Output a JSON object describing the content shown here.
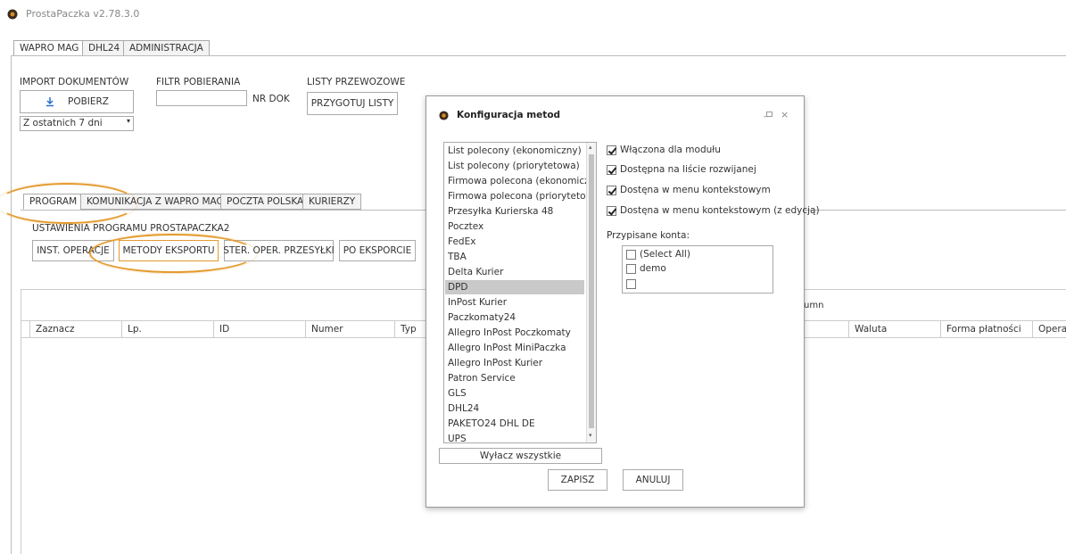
{
  "app": {
    "title": "ProstaPaczka v2.78.3.0",
    "logo_icon": "app-logo-icon"
  },
  "top_tabs": [
    {
      "label": "WAPRO MAG",
      "active": true
    },
    {
      "label": "DHL24",
      "active": false
    },
    {
      "label": "ADMINISTRACJA",
      "active": false
    }
  ],
  "import": {
    "label": "IMPORT DOKUMENTÓW",
    "button": "POBIERZ",
    "button_icon": "download-icon",
    "range_value": "Z ostatnich 7 dni"
  },
  "filter": {
    "label": "FILTR POBIERANIA",
    "value": "",
    "suffix": "NR DOK"
  },
  "waybills": {
    "label": "LISTY PRZEWOZOWE",
    "button": "PRZYGOTUJ LISTY"
  },
  "sub_tabs": [
    {
      "label": "PROGRAM",
      "active": true
    },
    {
      "label": "KOMUNIKACJA Z WAPRO MAG",
      "active": false
    },
    {
      "label": "POCZTA POLSKA",
      "active": false
    },
    {
      "label": "KURIERZY",
      "active": false
    }
  ],
  "settings": {
    "label": "USTAWIENIA PROGRAMU PROSTAPACZKA2",
    "buttons": [
      "INST. OPERACJE",
      "METODY EKSPORTU",
      "STER. OPER. PRZESYŁKI",
      "PO EKSPORCIE"
    ]
  },
  "grid": {
    "group_hint": "umn",
    "columns": [
      "Zaznacz",
      "Lp.",
      "ID",
      "Numer",
      "Typ",
      "Waluta",
      "Forma płatności",
      "Operat"
    ]
  },
  "modal": {
    "title": "Konfiguracja metod",
    "window_controls": [
      "minimize-icon",
      "maximize-icon",
      "close-icon"
    ],
    "methods": [
      "List polecony (ekonomiczny)",
      "List polecony (priorytetowa)",
      "Firmowa polecona (ekonomiczna)",
      "Firmowa polecona (priorytetowa)",
      "Przesyłka Kurierska 48",
      "Pocztex",
      "FedEx",
      "TBA",
      "Delta Kurier",
      "DPD",
      "InPost Kurier",
      "Paczkomaty24",
      "Allegro InPost Poczkomaty",
      "Allegro InPost MiniPaczka",
      "Allegro InPost Kurier",
      "Patron Service",
      "GLS",
      "DHL24",
      "PAKETO24 DHL DE",
      "UPS"
    ],
    "selected_method": "DPD",
    "options": [
      {
        "label": "Włączona dla modułu",
        "checked": true
      },
      {
        "label": "Dostępna na liście rozwijanej",
        "checked": true
      },
      {
        "label": "Dostęna w menu kontekstowym",
        "checked": true
      },
      {
        "label": "Dostęna w menu kontekstowym (z edycją)",
        "checked": true
      }
    ],
    "accounts_label": "Przypisane konta:",
    "accounts": [
      {
        "label": "(Select All)",
        "checked": false
      },
      {
        "label": "demo",
        "checked": false
      },
      {
        "label": "",
        "checked": false
      }
    ],
    "disable_all_button": "Wyłacz wszystkie",
    "save_button": "ZAPISZ",
    "cancel_button": "ANULUJ"
  },
  "colors": {
    "highlight": "#e49b2e",
    "selection": "#c9c9c9",
    "accent_blue": "#2a6fc9"
  }
}
